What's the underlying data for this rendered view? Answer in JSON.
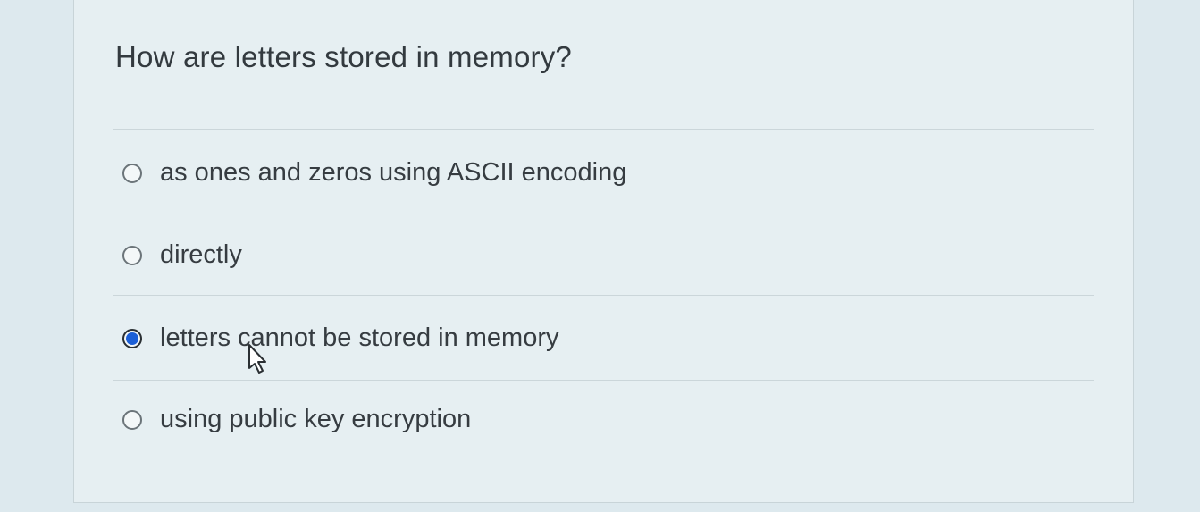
{
  "question": {
    "text": "How are letters stored in memory?"
  },
  "options": [
    {
      "label": "as ones and zeros using ASCII encoding",
      "selected": false
    },
    {
      "label": "directly",
      "selected": false
    },
    {
      "label": "letters cannot be stored in memory",
      "selected": true
    },
    {
      "label": "using public key encryption",
      "selected": false
    }
  ],
  "colors": {
    "background": "#dde9ee",
    "card": "#e6eff2",
    "radio_selected": "#1c5fd6",
    "text": "#363c41"
  },
  "icons": {
    "cursor": "mouse-pointer-icon",
    "radio": "radio-button-icon"
  }
}
